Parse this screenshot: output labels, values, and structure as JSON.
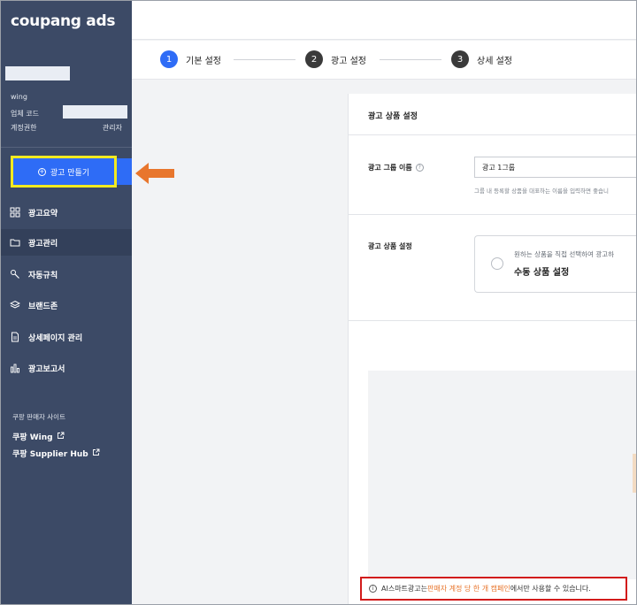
{
  "app": {
    "logo": "coupang ads"
  },
  "account": {
    "platform": "wing",
    "company_code_label": "업체 코드",
    "permission_label": "계정권한",
    "permission_value": "관리자"
  },
  "sidebar": {
    "create_button": "광고 만들기",
    "items": [
      {
        "label": "광고요약",
        "icon": "grid-icon"
      },
      {
        "label": "광고관리",
        "icon": "folder-icon"
      },
      {
        "label": "자동규칙",
        "icon": "wrench-icon"
      },
      {
        "label": "브랜드존",
        "icon": "layers-icon"
      },
      {
        "label": "상세페이지 관리",
        "icon": "document-icon"
      },
      {
        "label": "광고보고서",
        "icon": "bar-chart-icon"
      }
    ],
    "footer_title": "쿠팡 판매자 사이트",
    "footer_links": [
      {
        "label": "쿠팡 Wing",
        "icon": "external-link-icon"
      },
      {
        "label": "쿠팡 Supplier Hub",
        "icon": "external-link-icon"
      }
    ]
  },
  "stepper": {
    "steps": [
      {
        "num": "1",
        "label": "기본 설정"
      },
      {
        "num": "2",
        "label": "광고 설정"
      },
      {
        "num": "3",
        "label": "상세 설정"
      }
    ]
  },
  "form": {
    "title": "광고 상품 설정",
    "group_name_label": "광고 그룹 이름",
    "group_name_value": "광고 1그룹",
    "group_name_hint": "그룹 내 등록할 상품을 대표하는 이름을 입력하면 좋습니",
    "product_setting_label": "광고 상품 설정",
    "option_desc": "원하는 상품을 직접 선택하여 광고하",
    "option_title": "수동 상품 설정"
  },
  "notice": {
    "prefix": "AI스마트광고는 ",
    "highlight": "판매자 계정 당 한 개 캠페인",
    "suffix": "에서만 사용할 수 있습니다."
  },
  "colors": {
    "sidebar": "#3c4a66",
    "accent": "#2e6cf6",
    "highlight_box": "#f2ea20",
    "arrow": "#e8762d",
    "notice_border": "#d21b1b"
  }
}
